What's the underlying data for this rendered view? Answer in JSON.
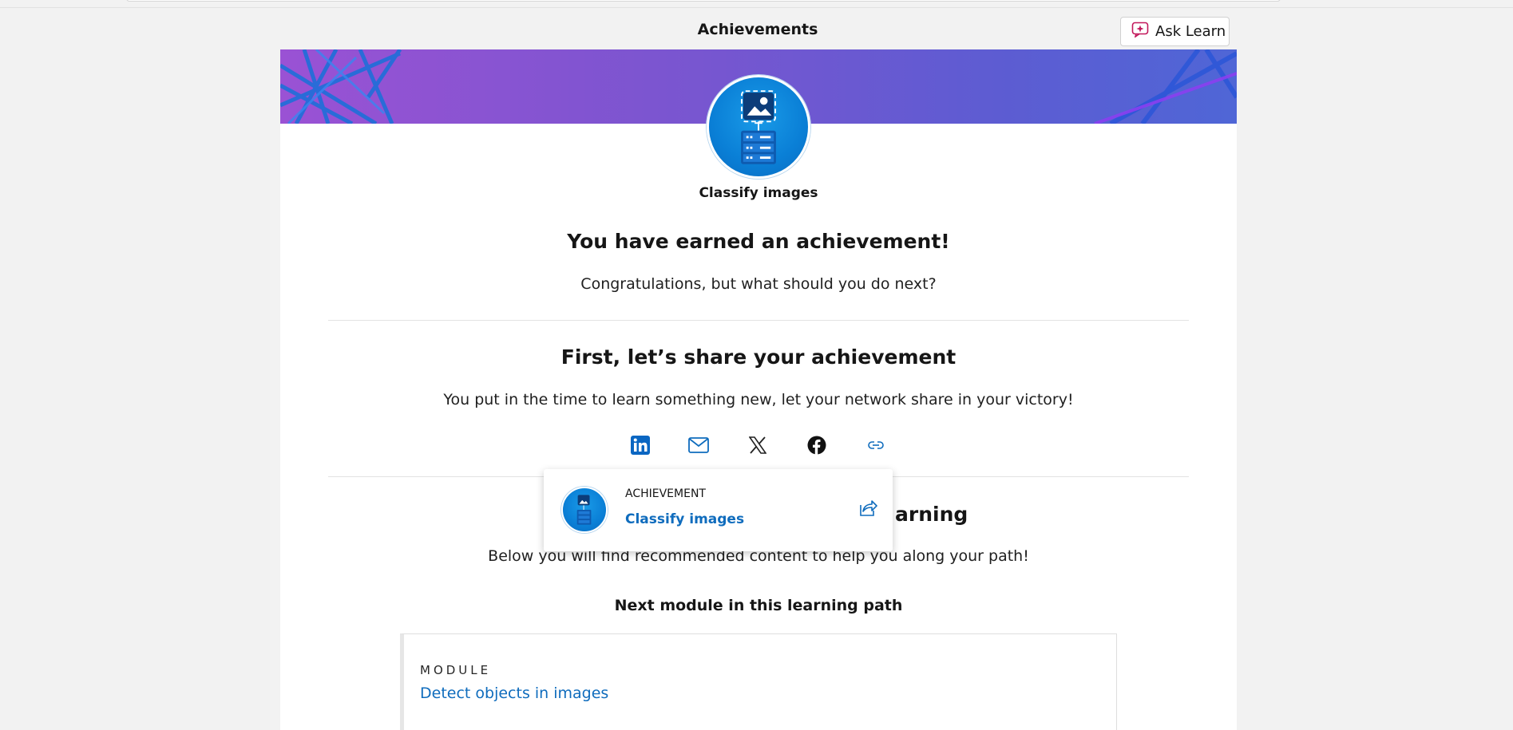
{
  "header": {
    "title": "Achievements",
    "ask_learn_label": "Ask Learn"
  },
  "achievement": {
    "name": "Classify images",
    "heading": "You have earned an achievement!",
    "subheading": "Congratulations, but what should you do next?"
  },
  "share": {
    "heading": "First, let’s share your achievement",
    "text": "You put in the time to learn something new, let your network share in your victory!",
    "icons": [
      "linkedin-icon",
      "mail-icon",
      "x-icon",
      "facebook-icon",
      "link-icon"
    ]
  },
  "continue": {
    "heading_visible": "arning",
    "text": "Below you will find recommended content to help you along your path!",
    "next_module_heading": "Next module in this learning path"
  },
  "module": {
    "label": "MODULE",
    "title": "Detect objects in images"
  },
  "popup": {
    "label": "ACHIEVEMENT",
    "title": "Classify images"
  },
  "colors": {
    "link": "#0f6cbd",
    "banner_start": "#9a52d4",
    "banner_end": "#4f66d6",
    "badge_blue": "#0a7fd6"
  }
}
